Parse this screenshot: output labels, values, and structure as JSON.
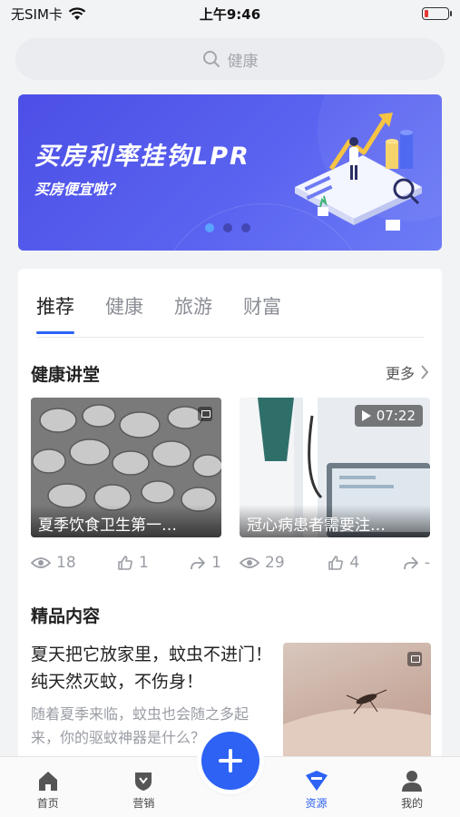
{
  "status_bar": {
    "carrier": "无SIM卡",
    "time": "上午9:46"
  },
  "search": {
    "placeholder": "健康"
  },
  "banner": {
    "title": "买房利率挂钩LPR",
    "subtitle": "买房便宜啦？",
    "page_indicator": {
      "count": 3,
      "active_index": 0
    }
  },
  "tabs": [
    {
      "label": "推荐",
      "active": true
    },
    {
      "label": "健康",
      "active": false
    },
    {
      "label": "旅游",
      "active": false
    },
    {
      "label": "财富",
      "active": false
    }
  ],
  "lecture_section": {
    "title": "健康讲堂",
    "more_label": "更多",
    "cards": [
      {
        "caption": "夏季饮食卫生第一…",
        "views": "18",
        "likes": "1",
        "shares": "1",
        "badge": "",
        "media_icon": "image-icon"
      },
      {
        "caption": "冠心病患者需要注…",
        "views": "29",
        "likes": "4",
        "shares": "-",
        "badge": "07:22",
        "media_icon": "play-icon"
      }
    ]
  },
  "featured_section": {
    "title": "精品内容",
    "article": {
      "title": "夏天把它放家里，蚊虫不进门！纯天然灭蚊，不伤身！",
      "description": "随着夏季来临，蚊虫也会随之多起来，你的驱蚊神器是什么？"
    }
  },
  "bottom_nav": [
    {
      "label": "首页",
      "icon": "home-icon",
      "active": false
    },
    {
      "label": "营销",
      "icon": "shield-icon",
      "active": false
    },
    {
      "label": "资源",
      "icon": "resource-icon",
      "active": true
    },
    {
      "label": "我的",
      "icon": "user-icon",
      "active": false
    }
  ],
  "colors": {
    "accent": "#2d62f5",
    "banner": "#5a63f0",
    "page_background": "#f2f3f5"
  }
}
